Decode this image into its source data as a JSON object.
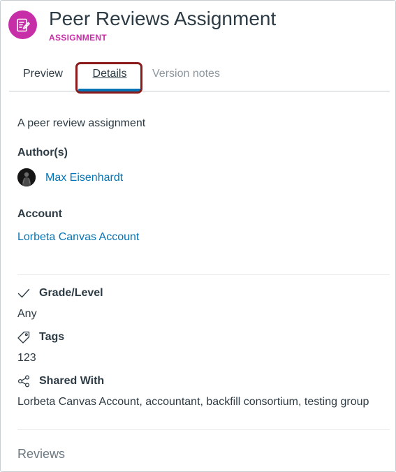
{
  "header": {
    "title": "Peer Reviews Assignment",
    "type_label": "ASSIGNMENT",
    "type_icon": "assignment-icon",
    "accent_color": "#c72fa8"
  },
  "tabs": [
    {
      "label": "Preview",
      "active": false
    },
    {
      "label": "Details",
      "active": true
    },
    {
      "label": "Version notes",
      "active": false
    }
  ],
  "details": {
    "description": "A peer review assignment",
    "authors_label": "Author(s)",
    "author_name": "Max Eisenhardt",
    "account_label": "Account",
    "account_name": "Lorbeta Canvas Account",
    "grade_label": "Grade/Level",
    "grade_value": "Any",
    "tags_label": "Tags",
    "tags_value": "123",
    "shared_label": "Shared With",
    "shared_value": "Lorbeta Canvas Account, accountant, backfill consortium, testing group"
  },
  "reviews_label": "Reviews",
  "colors": {
    "link": "#0374b5",
    "tab_indicator": "#0374b5",
    "focus_ring": "#8b1a1a"
  }
}
